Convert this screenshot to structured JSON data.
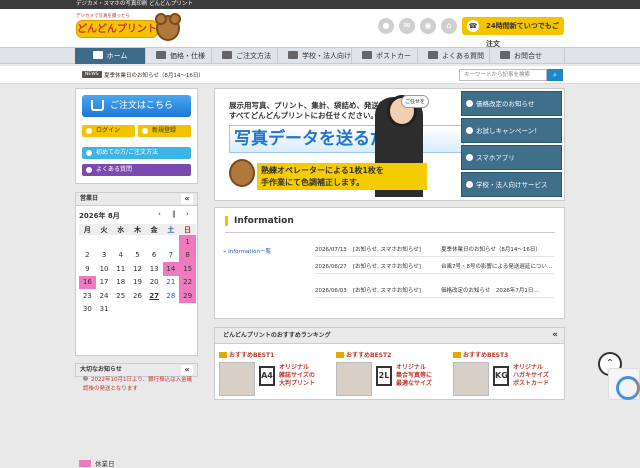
{
  "topbar": {
    "text": "デジカメ・スマホの写真印刷 どんどんプリント"
  },
  "logo": {
    "tagline": "デジカメで写真を撮ったら",
    "name": "どんどんプリント"
  },
  "header": {
    "order_button": "24時間新ていつでもご注文"
  },
  "nav": {
    "items": [
      "ホーム",
      "価格・仕様",
      "ご注文方法",
      "学校・法人向け",
      "ポストカード",
      "よくある質問",
      "お問合せ"
    ]
  },
  "news": {
    "badge": "NEWS",
    "text": "夏季休業日のお知らせ（8月14〜16日）"
  },
  "search": {
    "placeholder": "キーワードから記事を検索"
  },
  "sidebar": {
    "buy": "ご注文はこちら",
    "login": "ログイン",
    "register": "新規登録",
    "first": "初めての方/ご注文方法",
    "faq": "よくある質問",
    "eigyou": "営業日",
    "month": "2026年 8月",
    "weekdays": [
      "月",
      "火",
      "水",
      "木",
      "金",
      "土",
      "日"
    ],
    "weeks": [
      [
        "",
        "",
        "",
        "",
        "",
        "",
        "1"
      ],
      [
        "2",
        "3",
        "4",
        "5",
        "6",
        "7",
        "8"
      ],
      [
        "9",
        "10",
        "11",
        "12",
        "13",
        "14",
        "15"
      ],
      [
        "16",
        "17",
        "18",
        "19",
        "20",
        "21",
        "22"
      ],
      [
        "23",
        "24",
        "25",
        "26",
        "27",
        "28",
        "29"
      ],
      [
        "30",
        "31",
        "",
        "",
        "",
        "",
        ""
      ]
    ],
    "holiday_label": "休業日",
    "important": "大切なお知らせ",
    "important_text": "2022年10月1日より、銀行振込は入金確認後の発送となります"
  },
  "banner": {
    "text1": "展示用写真、プリント、集計、袋詰め、発送等",
    "text2": "すべてどんどんプリントにお任せください。",
    "big": "写真データを送るだけ",
    "yellow1": "熟練オペレーターによる1枚1枚を",
    "yellow2": "手作業にて色調補正します。",
    "bubble": "ご任せを",
    "side": [
      "価格改定のお知らせ",
      "お試しキャンペーン！",
      "スマホアプリ",
      "学校・法人向けサービス"
    ]
  },
  "info": {
    "title": "Information",
    "link": "» Information一覧",
    "rows": [
      {
        "date": "2026/07/13",
        "cat": "[お知らせ, スマホお知らせ]",
        "text": "夏季休業日のお知らせ（8月14〜16日）"
      },
      {
        "date": "2026/06/27",
        "cat": "[お知らせ, スマホお知らせ]",
        "text": "台風7号・8号の影響による発送遅延につい…"
      },
      {
        "date": "2026/06/03",
        "cat": "[お知らせ, スマホお知らせ]",
        "text": "価格改定のお知らせ　2026年7月1日…"
      }
    ]
  },
  "ranking": {
    "title": "どんどんプリントのおすすめランキング",
    "items": [
      {
        "label": "おすすめBEST1",
        "code": "A4",
        "desc1": "オリジナル",
        "desc2": "雑誌サイズの",
        "desc3": "大判プリント"
      },
      {
        "label": "おすすめBEST2",
        "code": "2L",
        "desc1": "オリジナル",
        "desc2": "集合写真等に",
        "desc3": "最適なサイズ"
      },
      {
        "label": "おすすめBEST3",
        "code": "KG",
        "desc1": "オリジナル",
        "desc2": "ハガキサイズ",
        "desc3": "ポストカード"
      }
    ]
  },
  "colors": {
    "nav_active": "#3e6a8a",
    "accent_yellow": "#f5c200",
    "holiday_pink": "#f07ac0",
    "link_blue": "#1e88c7"
  }
}
